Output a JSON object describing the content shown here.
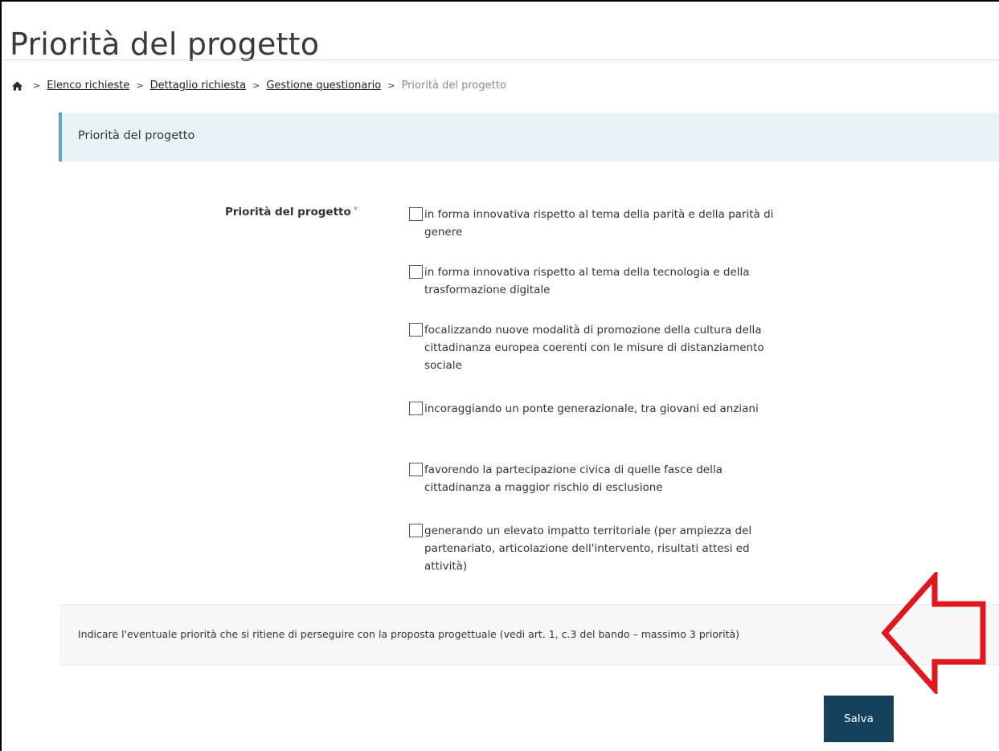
{
  "page": {
    "title": "Priorità del progetto"
  },
  "breadcrumb": {
    "items": [
      "Elenco richieste",
      "Dettaglio richiesta",
      "Gestione questionario"
    ],
    "current": "Priorità del progetto",
    "separator": ">"
  },
  "section": {
    "header": "Priorità del progetto"
  },
  "field": {
    "label": "Priorità del progetto",
    "required_marker": "*",
    "options": [
      {
        "label": "in forma innovativa rispetto al tema della parità e della parità di genere",
        "checked": false
      },
      {
        "label": "in forma innovativa rispetto al tema della tecnologia e della trasformazione digitale",
        "checked": false
      },
      {
        "label": "focalizzando nuove modalità di promozione della cultura della cittadinanza europea coerenti con le misure di distanziamento sociale",
        "checked": false
      },
      {
        "label": "incoraggiando un ponte generazionale, tra giovani ed anziani",
        "checked": false
      },
      {
        "label": "favorendo la partecipazione civica di quelle fasce della cittadinanza a maggior rischio di esclusione",
        "checked": false
      },
      {
        "label": "generando un elevato impatto territoriale (per ampiezza del partenariato, articolazione dell'intervento, risultati attesi ed attività)",
        "checked": false
      }
    ]
  },
  "help": {
    "text": "Indicare l'eventuale priorità che si ritiene di perseguire con la proposta progettuale (vedi art. 1, c.3 del bando – massimo 3 priorità)"
  },
  "actions": {
    "save_label": "Salva"
  },
  "icons": {
    "home": "home-icon",
    "annotation": "arrow-left-annotation"
  },
  "colors": {
    "accent": "#5ba3c9",
    "header_bg": "#e8f3f8",
    "button_bg": "#16415c",
    "required": "#d9534f",
    "annotation": "#e0171f"
  }
}
